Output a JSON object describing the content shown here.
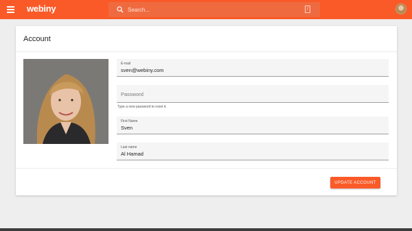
{
  "header": {
    "logo_text": "webiny",
    "search_placeholder": "Search...",
    "search_shortcut": "/",
    "accent_color": "#fa5a28"
  },
  "account": {
    "title": "Account",
    "fields": {
      "email": {
        "label": "E-mail",
        "value": "sven@webiny.com"
      },
      "password": {
        "placeholder": "Password",
        "helper": "Type a new password to reset it."
      },
      "first_name": {
        "label": "First Name",
        "value": "Sven"
      },
      "last_name": {
        "label": "Last name",
        "value": "Al Hamad"
      }
    },
    "update_label": "UPDATE ACCOUNT"
  },
  "icons": [
    "menu-icon",
    "search-icon",
    "slash-key-icon",
    "user-avatar"
  ]
}
